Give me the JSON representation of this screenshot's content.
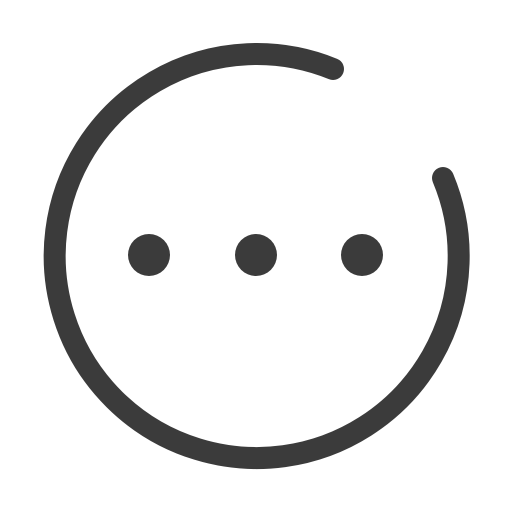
{
  "icon": {
    "name": "more-options-circle-icon",
    "stroke_color": "#3b3b3b",
    "background": "#ffffff",
    "dot_count": 3
  }
}
